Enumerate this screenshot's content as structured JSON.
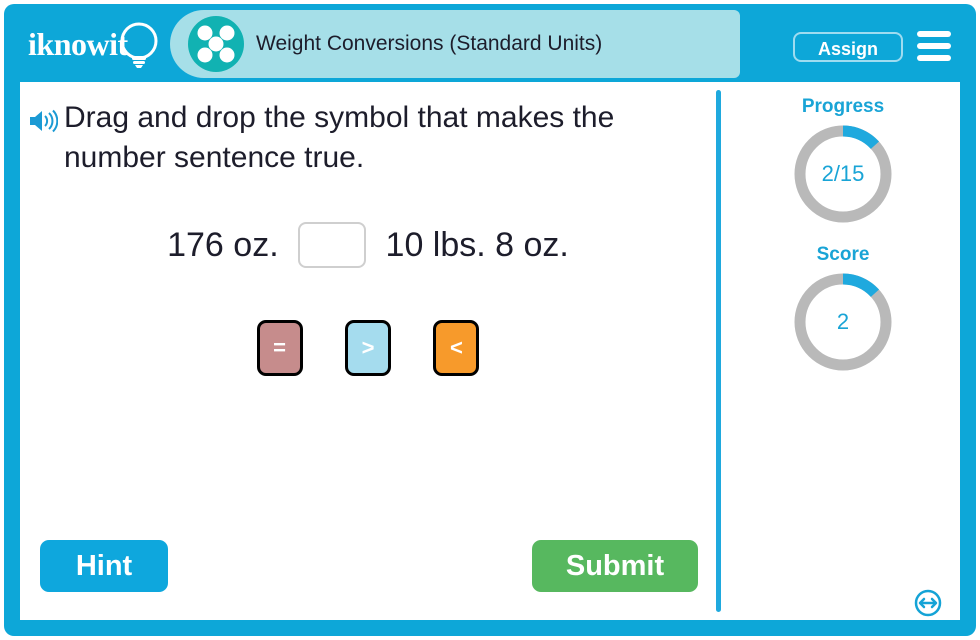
{
  "header": {
    "logo_text": "iknowit",
    "logo_icon": "lightbulb-icon",
    "title_icon": "five-dot-circle-icon",
    "title": "Weight Conversions (Standard Units)",
    "assign_label": "Assign",
    "menu_icon": "hamburger-menu-icon"
  },
  "question": {
    "audio_icon": "speaker-icon",
    "text": "Drag and drop the symbol that makes the number sentence true."
  },
  "sentence": {
    "left": "176 oz.",
    "blank_value": "",
    "right": "10 lbs. 8 oz."
  },
  "tiles": [
    {
      "symbol": "=",
      "color": "#c68c8c",
      "name": "tile-equals"
    },
    {
      "symbol": ">",
      "color": "#a5dcee",
      "name": "tile-greater-than"
    },
    {
      "symbol": "<",
      "color": "#f79a2b",
      "name": "tile-less-than"
    }
  ],
  "meters": {
    "progress": {
      "label": "Progress",
      "value": "2/15",
      "current": 2,
      "total": 15,
      "percent": 13.3
    },
    "score": {
      "label": "Score",
      "value": "2",
      "current": 2,
      "total": 15,
      "percent": 13.3
    },
    "track_color": "#b9b9b9",
    "fill_color": "#1fa9de"
  },
  "footer": {
    "hint_label": "Hint",
    "submit_label": "Submit",
    "resize_icon": "resize-horizontal-icon"
  },
  "colors": {
    "frame_blue": "#0da7d8",
    "title_panel": "#a6dfe8",
    "accent_blue": "#19a4d6",
    "submit_green": "#57b85f"
  }
}
